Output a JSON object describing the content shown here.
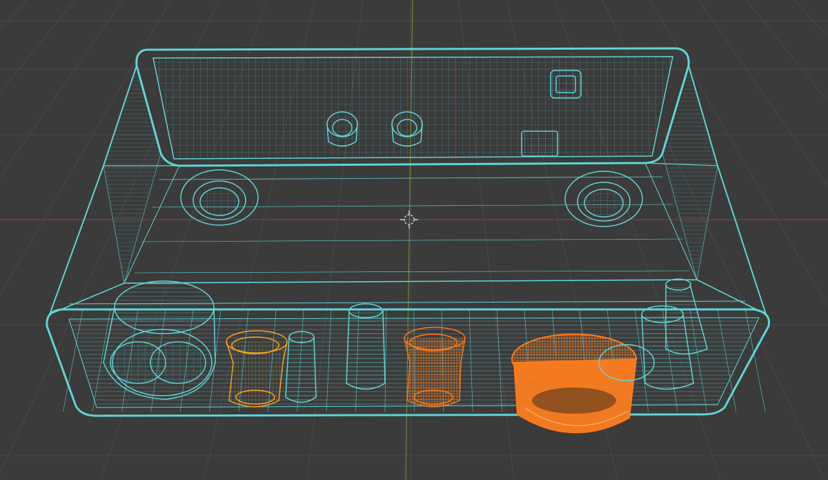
{
  "viewport": {
    "name": "3d-viewport-wireframe",
    "background": "#3b3b3b",
    "grid_color": "#4a4a4a",
    "x_axis_color": "#8a3b46",
    "y_axis_color": "#6f8a2e"
  },
  "colors": {
    "wire_unselected": "#5fd5d8",
    "wire_selected_active": "#ff7a1a",
    "wire_selected": "#ffa31a",
    "origin_marker": "#cfcfcf"
  },
  "objects": [
    {
      "name": "enclosure-box",
      "selected": false
    },
    {
      "name": "rotary-encoder",
      "selected": false
    },
    {
      "name": "led-holder-left",
      "selected": true
    },
    {
      "name": "standoff-post-1",
      "selected": false
    },
    {
      "name": "standoff-post-2",
      "selected": false
    },
    {
      "name": "led-holder-right",
      "selected": true
    },
    {
      "name": "knob-cap",
      "selected": true,
      "active": true
    },
    {
      "name": "standoff-post-3",
      "selected": false
    },
    {
      "name": "standoff-post-4",
      "selected": false
    }
  ]
}
